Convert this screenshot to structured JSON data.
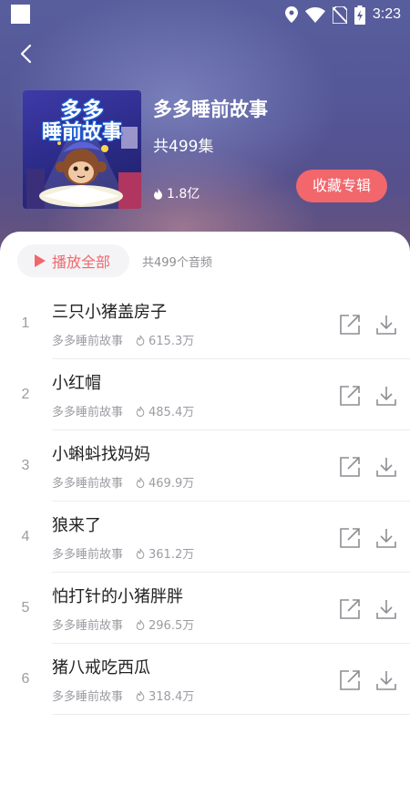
{
  "status_bar": {
    "time": "3:23",
    "icons": [
      "location-icon",
      "wifi-icon",
      "no-sim-icon",
      "battery-charging-icon"
    ]
  },
  "album": {
    "cover_text_line1": "多多",
    "cover_text_line2": "睡前故事",
    "title": "多多睡前故事",
    "episode_count": "共499集",
    "plays": "1.8亿",
    "favorite_label": "收藏专辑"
  },
  "toolbar": {
    "play_all_label": "播放全部",
    "total_audio": "共499个音频"
  },
  "tracks": [
    {
      "index": "1",
      "title": "三只小猪盖房子",
      "artist": "多多睡前故事",
      "plays": "615.3万"
    },
    {
      "index": "2",
      "title": "小红帽",
      "artist": "多多睡前故事",
      "plays": "485.4万"
    },
    {
      "index": "3",
      "title": "小蝌蚪找妈妈",
      "artist": "多多睡前故事",
      "plays": "469.9万"
    },
    {
      "index": "4",
      "title": "狼来了",
      "artist": "多多睡前故事",
      "plays": "361.2万"
    },
    {
      "index": "5",
      "title": "怕打针的小猪胖胖",
      "artist": "多多睡前故事",
      "plays": "296.5万"
    },
    {
      "index": "6",
      "title": "猪八戒吃西瓜",
      "artist": "多多睡前故事",
      "plays": "318.4万"
    },
    {
      "index": "7",
      "title": "",
      "artist": "",
      "plays": ""
    }
  ],
  "colors": {
    "accent": "#f1676c",
    "header_top": "#585e9d",
    "header_bottom": "#6a5578",
    "text_primary": "#222222",
    "text_secondary": "#9c9ca3"
  }
}
